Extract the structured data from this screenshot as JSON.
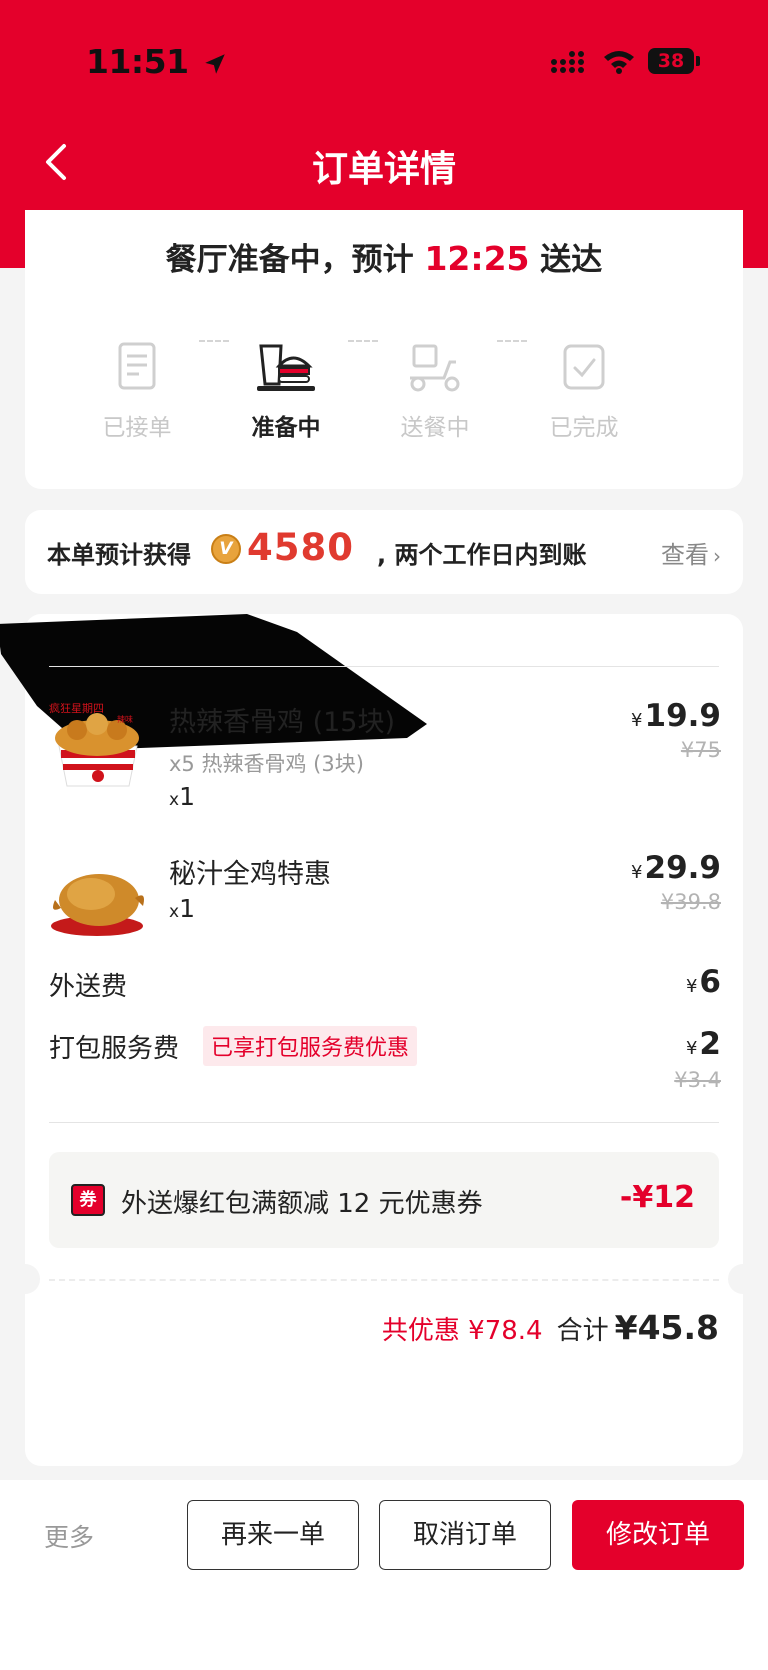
{
  "status_bar": {
    "time": "11:51",
    "battery": "38"
  },
  "nav": {
    "title": "订单详情"
  },
  "status": {
    "prefix": "餐厅准备中，预计 ",
    "eta": "12:25",
    "suffix": " 送达",
    "steps": [
      {
        "label": "已接单",
        "icon": "receipt-icon",
        "active": false
      },
      {
        "label": "准备中",
        "icon": "burger-icon",
        "active": true
      },
      {
        "label": "送餐中",
        "icon": "scooter-icon",
        "active": false
      },
      {
        "label": "已完成",
        "icon": "check-bag-icon",
        "active": false
      }
    ]
  },
  "points": {
    "prefix": "本单预计获得",
    "badge": "V",
    "amount": "4580",
    "suffix": ", 两个工作日内到账",
    "link": "查看"
  },
  "items": [
    {
      "name": "热辣香骨鸡 (15块)",
      "sub": "x5 热辣香骨鸡 (3块)",
      "qty_x": "x",
      "qty": "1",
      "price": "19.9",
      "original": "¥75"
    },
    {
      "name": "秘汁全鸡特惠",
      "qty_x": "x",
      "qty": "1",
      "price": "29.9",
      "original": "¥39.8"
    }
  ],
  "fees": {
    "delivery": {
      "label": "外送费",
      "price": "6"
    },
    "packing": {
      "label": "打包服务费",
      "tag": "已享打包服务费优惠",
      "price": "2",
      "original": "¥3.4"
    }
  },
  "coupon": {
    "icon": "券",
    "text": "外送爆红包满额减 12 元优惠券",
    "amount": "-¥12"
  },
  "totals": {
    "discount": "共优惠 ¥78.4",
    "label": "合计",
    "total": "¥45.8"
  },
  "bottom": {
    "more": "更多",
    "reorder": "再来一单",
    "cancel": "取消订单",
    "modify": "修改订单"
  },
  "currency": "¥",
  "colors": {
    "brand_red": "#e4002b",
    "points_red": "#e03a2f"
  }
}
